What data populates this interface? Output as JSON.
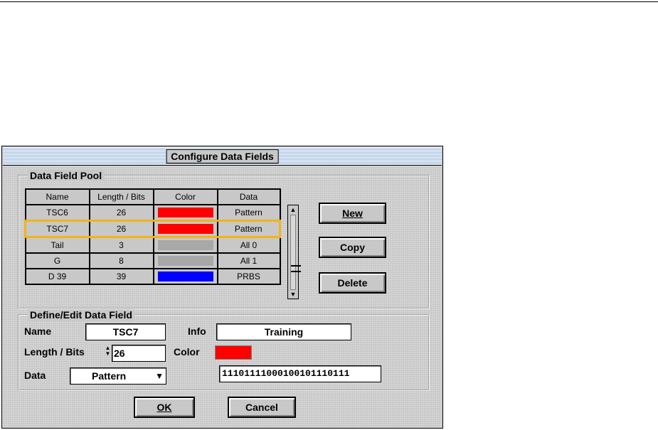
{
  "dialog": {
    "title": "Configure Data Fields"
  },
  "pool": {
    "label": "Data Field Pool",
    "columns": [
      "Name",
      "Length / Bits",
      "Color",
      "Data"
    ],
    "rows": [
      {
        "name": "TSC6",
        "length": "26",
        "color": "#ff0000",
        "data": "Pattern"
      },
      {
        "name": "TSC7",
        "length": "26",
        "color": "#ff0000",
        "data": "Pattern"
      },
      {
        "name": "Tail",
        "length": "3",
        "color": "#a8a8a8",
        "data": "All 0"
      },
      {
        "name": "G",
        "length": "8",
        "color": "#a8a8a8",
        "data": "All 1"
      },
      {
        "name": "D 39",
        "length": "39",
        "color": "#0000ff",
        "data": "PRBS"
      }
    ],
    "selected_row": 1,
    "buttons": {
      "new": "New",
      "copy": "Copy",
      "delete": "Delete"
    }
  },
  "edit": {
    "label": "Define/Edit Data Field",
    "name_label": "Name",
    "name_value": "TSC7",
    "info_label": "Info",
    "info_value": "Training",
    "length_label": "Length / Bits",
    "length_value": "26",
    "color_label": "Color",
    "color_value": "#ff0000",
    "data_label": "Data",
    "data_value": "Pattern",
    "pattern_value": "11101111000100101110111"
  },
  "footer": {
    "ok": "OK",
    "cancel": "Cancel"
  },
  "icons": {
    "spinner": "up-down-arrows-icon",
    "dropdown": "chevron-down-icon"
  }
}
